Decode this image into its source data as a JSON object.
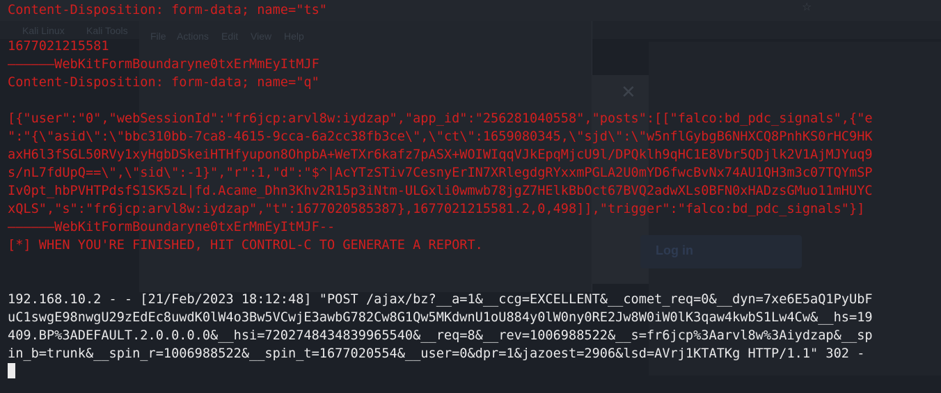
{
  "background": {
    "menu_items": [
      "File",
      "Actions",
      "Edit",
      "View",
      "Help"
    ],
    "bookmarks": [
      "Kali Linux",
      "Kali Tools"
    ],
    "login_label": "Log in"
  },
  "terminal": {
    "colors": {
      "red": "#d21f1f",
      "white": "#e9e9ea"
    },
    "lines": [
      {
        "id": "l01",
        "color": "red",
        "text": "Content-Disposition: form-data; name=\"ts\""
      },
      {
        "id": "l02",
        "color": "red",
        "text": ""
      },
      {
        "id": "l03",
        "color": "red",
        "text": "1677021215581"
      },
      {
        "id": "l04",
        "color": "red",
        "text": "——————WebKitFormBoundaryne0txErMmEyItMJF"
      },
      {
        "id": "l05",
        "color": "red",
        "text": "Content-Disposition: form-data; name=\"q\""
      },
      {
        "id": "l06",
        "color": "red",
        "text": ""
      },
      {
        "id": "l07",
        "color": "red",
        "text": "[{\"user\":\"0\",\"webSessionId\":\"fr6jcp:arvl8w:iydzap\",\"app_id\":\"256281040558\",\"posts\":[[\"falco:bd_pdc_signals\",{\"e"
      },
      {
        "id": "l08",
        "color": "red",
        "text": "\":\"{\\\"asid\\\":\\\"bbc310bb-7ca8-4615-9cca-6a2cc38fb3ce\\\",\\\"ct\\\":1659080345,\\\"sjd\\\":\\\"w5nflGybgB6NHXCQ8PnhKS0rHC9HK"
      },
      {
        "id": "l09",
        "color": "red",
        "text": "axH6l3fSGL50RVy1xyHgbDSkeiHTHfyupon8OhpbA+WeTXr6kafz7pASX+WOIWIqqVJkEpqMjcU9l/DPQklh9qHC1E8Vbr5QDjlk2V1AjMJYuq9"
      },
      {
        "id": "l10",
        "color": "red",
        "text": "s/nL7fdUpQ==\\\",\\\"sid\\\":-1}\",\"r\":1,\"d\":\"$^|AcYTzSTiv7CesnyErIN7XRlegdgRYxxmPGLA2U0mYD6fwcBvNx74AU1QH3m3c07TQYmSP"
      },
      {
        "id": "l11",
        "color": "red",
        "text": "Iv0pt_hbPVHTPdsfS1SK5zL|fd.Acame_Dhn3Khv2R15p3iNtm-ULGxli0wmwb78jgZ7HElkBbOct67BVQ2adwXLs0BFN0xHADzsGMuo11mHUYC"
      },
      {
        "id": "l12",
        "color": "red",
        "text": "xQLS\",\"s\":\"fr6jcp:arvl8w:iydzap\",\"t\":1677020585387},1677021215581.2,0,498]],\"trigger\":\"falco:bd_pdc_signals\"}]"
      },
      {
        "id": "l13",
        "color": "red",
        "text": "——————WebKitFormBoundaryne0txErMmEyItMJF--"
      },
      {
        "id": "l14",
        "color": "red",
        "text": "[*] WHEN YOU'RE FINISHED, HIT CONTROL-C TO GENERATE A REPORT."
      },
      {
        "id": "l15",
        "color": "white",
        "text": ""
      },
      {
        "id": "l16",
        "color": "white",
        "text": ""
      },
      {
        "id": "l17",
        "color": "white",
        "text": "192.168.10.2 - - [21/Feb/2023 18:12:48] \"POST /ajax/bz?__a=1&__ccg=EXCELLENT&__comet_req=0&__dyn=7xe6E5aQ1PyUbF"
      },
      {
        "id": "l18",
        "color": "white",
        "text": "uC1swgE98nwgU29zEdEc8uwdK0lW4o3Bw5VCwjE3awbG782Cw8G1Qw5MKdwnU1oU884y0lW0ny0RE2Jw8W0iW0lK3qaw4kwbS1Lw4Cw&__hs=19"
      },
      {
        "id": "l19",
        "color": "white",
        "text": "409.BP%3ADEFAULT.2.0.0.0.0&__hsi=7202748434839965540&__req=8&__rev=1006988522&__s=fr6jcp%3Aarvl8w%3Aiydzap&__sp"
      },
      {
        "id": "l20",
        "color": "white",
        "text": "in_b=trunk&__spin_r=1006988522&__spin_t=1677020554&__user=0&dpr=1&jazoest=2906&lsd=AVrj1KTATKg HTTP/1.1\" 302 -"
      }
    ]
  }
}
